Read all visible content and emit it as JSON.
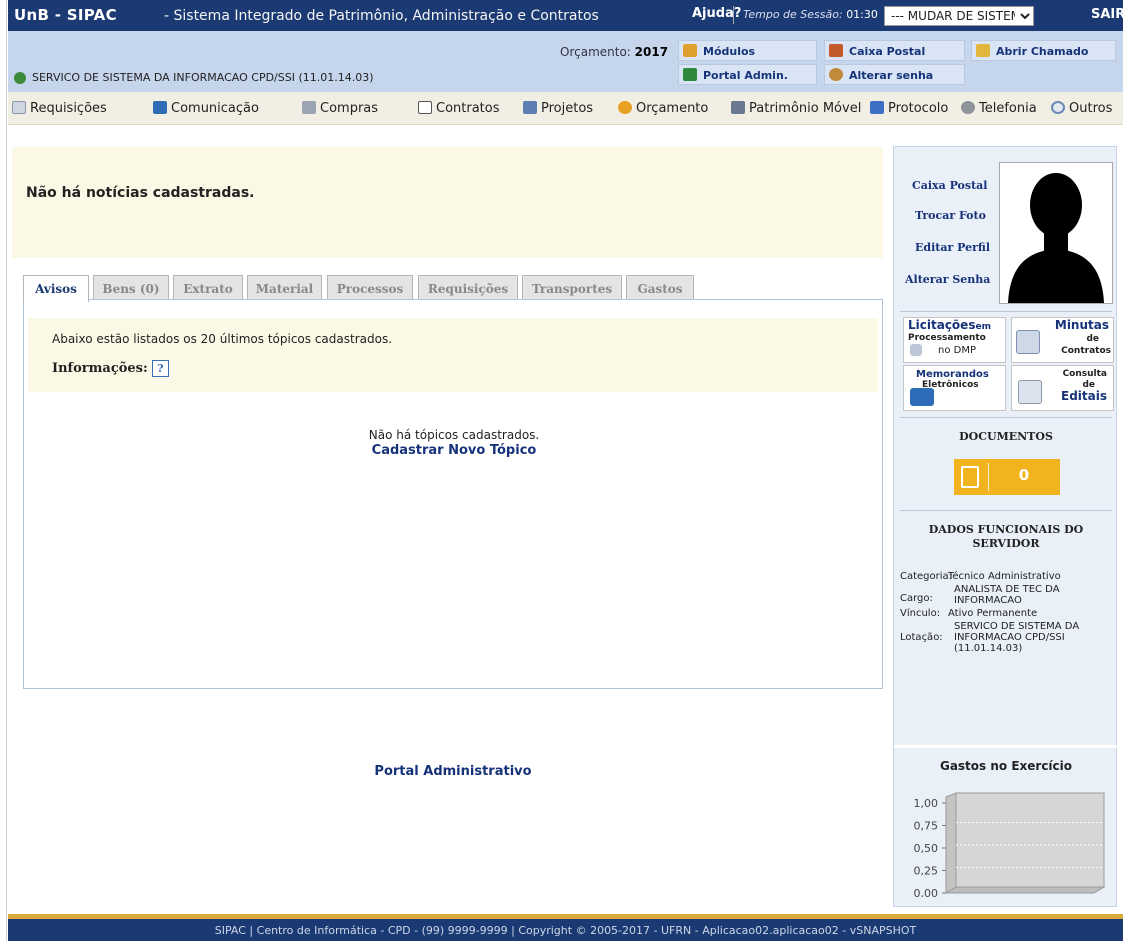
{
  "topbar": {
    "system_name": "UnB - SIPAC",
    "system_full": "- Sistema Integrado de Patrimônio, Administração e Contratos",
    "help": "Ajuda?",
    "session_label": "Tempo de Sessão:",
    "session_value": "01:30",
    "change_system": "--- MUDAR DE SISTEMA ---",
    "exit": "SAIR"
  },
  "info": {
    "budget_label": "Orçamento:",
    "budget_year": "2017",
    "unit": "SERVICO DE SISTEMA DA INFORMACAO CPD/SSI (11.01.14.03)",
    "links": {
      "modules": "Módulos",
      "mailbox": "Caixa Postal",
      "open_ticket": "Abrir Chamado",
      "admin_portal": "Portal Admin.",
      "change_password": "Alterar senha"
    }
  },
  "menu": {
    "items": [
      "Requisições",
      "Comunicação",
      "Compras",
      "Contratos",
      "Projetos",
      "Orçamento",
      "Patrimônio Móvel",
      "Protocolo",
      "Telefonia",
      "Outros"
    ]
  },
  "news": {
    "text": "Não há notícias cadastradas."
  },
  "tabs": [
    "Avisos",
    "Bens (0)",
    "Extrato",
    "Material",
    "Processos",
    "Requisições",
    "Transportes",
    "Gastos"
  ],
  "panel": {
    "notice": "Abaixo estão listados os 20 últimos tópicos cadastrados.",
    "info_label": "Informações:",
    "help_icon": "?",
    "empty": "Não há tópicos cadastrados.",
    "new_topic": "Cadastrar Novo Tópico"
  },
  "portal_link": "Portal Administrativo",
  "sidebar": {
    "profile_links": [
      "Caixa Postal",
      "Trocar Foto",
      "Editar Perfil",
      "Alterar Senha"
    ],
    "widgets": {
      "licitacoes": {
        "l1": "Licitações",
        "l1b": "em",
        "l2": "Processamento",
        "l3": "no DMP"
      },
      "minutas": {
        "l1": "Minutas",
        "l2": "de",
        "l3": "Contratos"
      },
      "memorandos": {
        "l1": "Memorandos",
        "l2": "Eletrônicos"
      },
      "editais": {
        "l1": "Consulta",
        "l2": "de",
        "l3": "Editais"
      }
    },
    "documents_title": "DOCUMENTOS",
    "documents_count": "0",
    "dados_title": "DADOS FUNCIONAIS DO SERVIDOR",
    "dados": [
      {
        "label": "Categoria:",
        "value": "Técnico Administrativo"
      },
      {
        "label": "Cargo:",
        "value": "ANALISTA DE TEC DA INFORMACAO"
      },
      {
        "label": "Vínculo:",
        "value": "Ativo Permanente"
      },
      {
        "label": "Lotação:",
        "value": "SERVICO DE SISTEMA DA INFORMACAO CPD/SSI (11.01.14.03)"
      }
    ],
    "gastos_title": "Gastos no Exercício"
  },
  "chart_data": {
    "type": "bar",
    "title": "Gastos no Exercício",
    "categories": [],
    "values": [],
    "ylim": [
      0,
      1
    ],
    "yticks": [
      "1,00",
      "0,75",
      "0,50",
      "0,25",
      "0,00"
    ],
    "grid": true
  },
  "footer": "SIPAC | Centro de Informática - CPD - (99) 9999-9999 | Copyright © 2005-2017 - UFRN - Aplicacao02.aplicacao02 - vSNAPSHOT",
  "colors": {
    "header_bg": "#1b3a73",
    "info_bg": "#c5d6ec",
    "link": "#16337a",
    "document_badge": "#f2b41e"
  }
}
